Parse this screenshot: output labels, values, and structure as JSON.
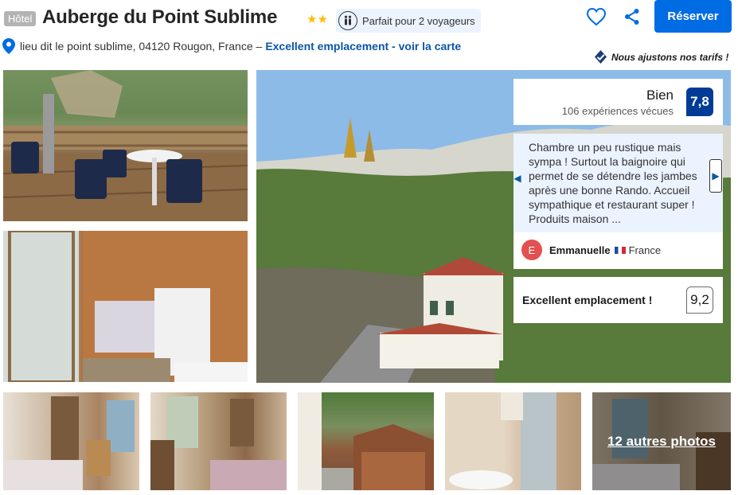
{
  "header": {
    "type_badge": "Hôtel",
    "title": "Auberge du Point Sublime",
    "stars": "★★",
    "stars_count": 2,
    "travel_label": "Parfait pour 2 voyageurs",
    "address": "lieu dit le point sublime, 04120 Rougon, France –",
    "map_link": "Excellent emplacement - voir la carte",
    "reserve_label": "Réserver",
    "price_guarantee": "Nous ajustons nos tarifs !"
  },
  "rating": {
    "word": "Bien",
    "count": "106 expériences vécues",
    "score": "7,8"
  },
  "review": {
    "text": "Chambre un peu rustique mais sympa ! Surtout la baignoire qui permet de se détendre les jambes après une bonne Rando. Accueil sympathique et restaurant super ! Produits maison ...",
    "avatar_initial": "E",
    "reviewer_name": "Emmanuelle",
    "reviewer_country": "France",
    "prev_glyph": "◀",
    "next_glyph": "▶"
  },
  "location": {
    "label": "Excellent emplacement !",
    "score": "9,2"
  },
  "gallery": {
    "more_photos": "12 autres photos"
  },
  "colors": {
    "brand_blue": "#006ce4",
    "score_blue": "#003b95",
    "link_blue": "#0b56a7",
    "star_yellow": "#febb02",
    "chip_bg": "#ebf3ff",
    "avatar_red": "#e2504f"
  },
  "icons": [
    "map-pin-icon",
    "couple-icon",
    "heart-icon",
    "share-icon",
    "check-shield-icon",
    "chevron-left-icon",
    "chevron-right-icon"
  ]
}
